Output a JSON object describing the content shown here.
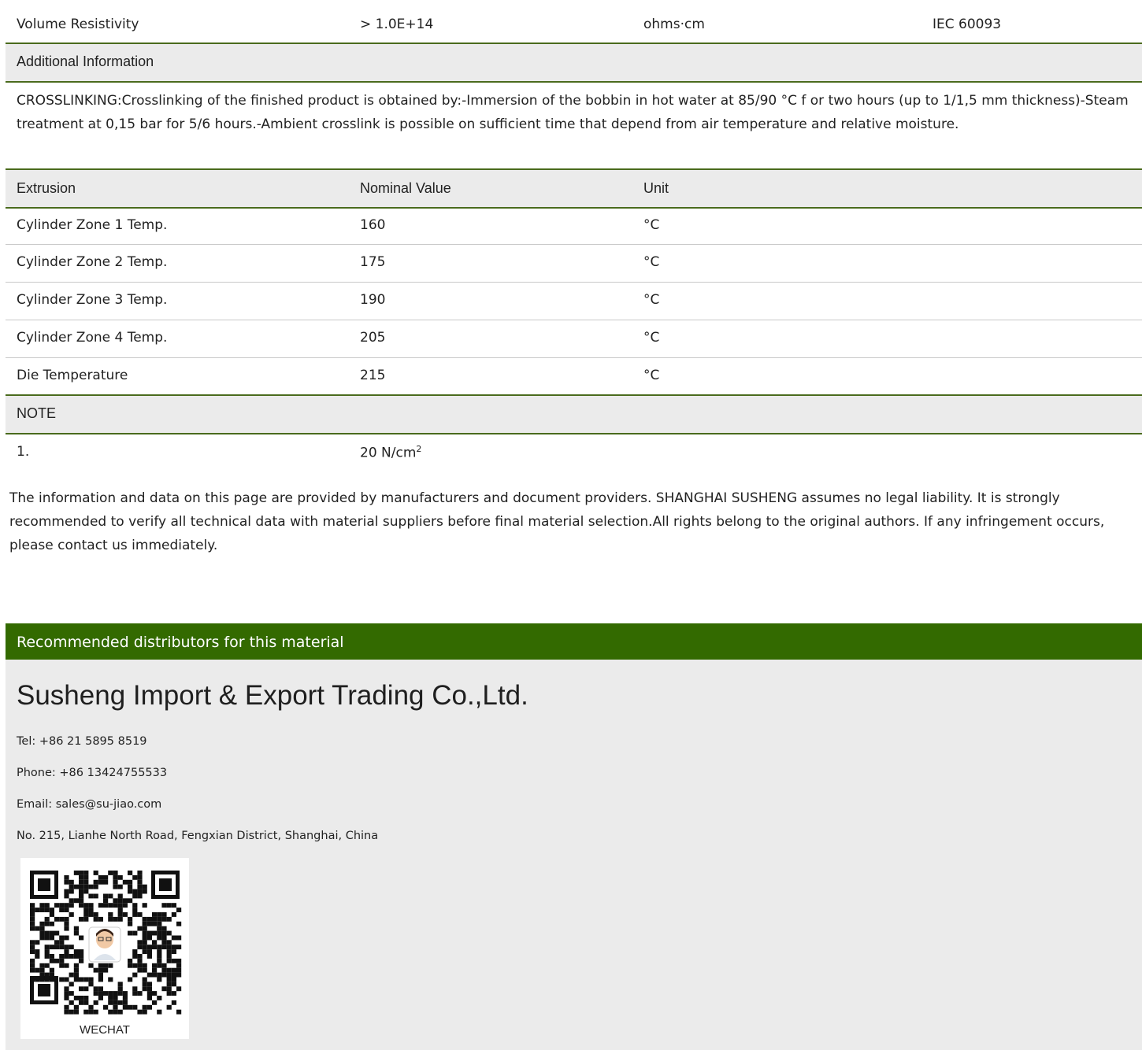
{
  "top_row": {
    "property": "Volume Resistivity",
    "value": "> 1.0E+14",
    "unit": "ohms·cm",
    "method": "IEC 60093"
  },
  "additional_info": {
    "header": "Additional Information",
    "text": "CROSSLINKING:Crosslinking of the finished product is obtained by:-Immersion of the bobbin in hot water at 85/90 °C f or two hours (up to 1/1,5 mm thickness)-Steam treatment at 0,15 bar for 5/6 hours.-Ambient crosslink is possible on sufficient time that depend from air temperature and relative moisture."
  },
  "extrusion": {
    "headers": [
      "Extrusion",
      "Nominal Value",
      "Unit"
    ],
    "rows": [
      {
        "property": "Cylinder Zone 1 Temp.",
        "value": "160",
        "unit": "°C"
      },
      {
        "property": "Cylinder Zone 2 Temp.",
        "value": "175",
        "unit": "°C"
      },
      {
        "property": "Cylinder Zone 3 Temp.",
        "value": "190",
        "unit": "°C"
      },
      {
        "property": "Cylinder Zone 4 Temp.",
        "value": "205",
        "unit": "°C"
      },
      {
        "property": "Die Temperature",
        "value": "215",
        "unit": "°C"
      }
    ]
  },
  "note": {
    "header": "NOTE",
    "number": "1.",
    "value": "20 N/cm",
    "superscript": "2"
  },
  "disclaimer": "The information and data on this page are provided by manufacturers and document providers.  SHANGHAI SUSHENG  assumes no legal liability. It is strongly recommended to verify all technical data with material suppliers before final material selection.All rights belong to the original authors. If any infringement occurs, please contact us immediately.",
  "distributor": {
    "bar_title": "Recommended distributors for this material",
    "company": "Susheng Import & Export Trading Co.,Ltd.",
    "tel": "Tel: +86 21 5895 8519",
    "phone": "Phone: +86 13424755533",
    "email": "Email: sales@su-jiao.com",
    "address": "No. 215, Lianhe North Road, Fengxian District, Shanghai, China",
    "qr_label": "WECHAT"
  },
  "colors": {
    "accent_green": "#336a00",
    "header_border": "#4a6b1d",
    "header_bg": "#ebebeb"
  }
}
